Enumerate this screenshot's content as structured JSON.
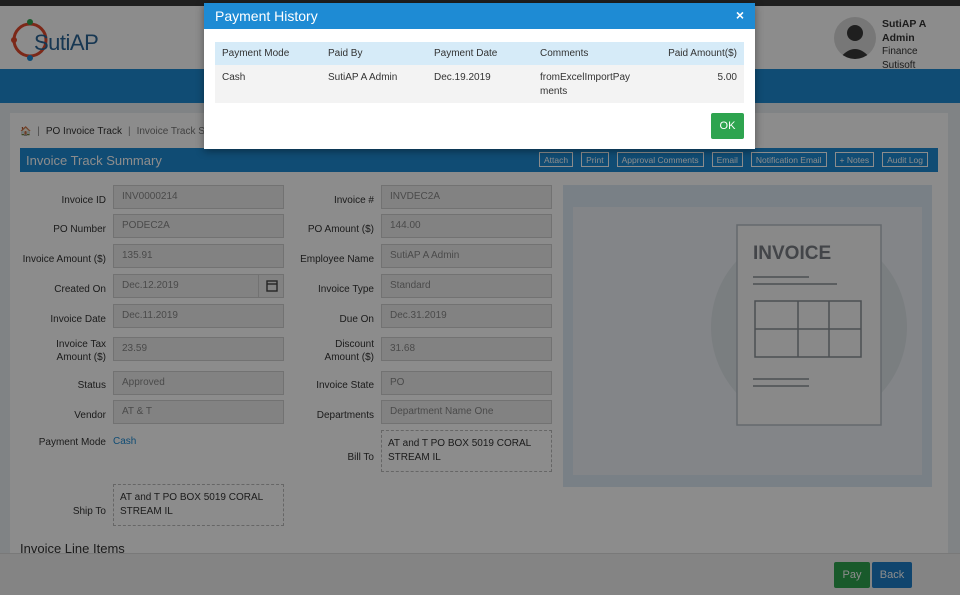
{
  "header": {
    "logo_text": "SutiAP",
    "user": {
      "name": "SutiAP A Admin",
      "role": "Finance",
      "company": "Sutisoft"
    }
  },
  "breadcrumb": {
    "home": "🏠",
    "item1": "PO Invoice Track",
    "item2": "Invoice Track Sur"
  },
  "section": {
    "title": "Invoice Track Summary",
    "toolbar": [
      "Attach",
      "Print",
      "Approval Comments",
      "Email",
      "Notification Email",
      "+ Notes",
      "Audit Log"
    ]
  },
  "form": {
    "invoice_id": {
      "label": "Invoice ID",
      "value": "INV0000214"
    },
    "po_number": {
      "label": "PO Number",
      "value": "PODEC2A"
    },
    "invoice_amount": {
      "label": "Invoice Amount ($)",
      "value": "135.91"
    },
    "created_on": {
      "label": "Created On",
      "value": "Dec.12.2019"
    },
    "invoice_date": {
      "label": "Invoice Date",
      "value": "Dec.11.2019"
    },
    "invoice_tax_label1": "Invoice Tax",
    "invoice_tax_label2": "Amount ($)",
    "invoice_tax": "23.59",
    "status": {
      "label": "Status",
      "value": "Approved"
    },
    "vendor": {
      "label": "Vendor",
      "value": "AT & T"
    },
    "payment_mode": {
      "label": "Payment Mode",
      "value": "Cash"
    },
    "ship_to": {
      "label": "Ship To",
      "line1": "AT and T PO BOX 5019 CORAL",
      "line2": "STREAM IL"
    },
    "invoice_no": {
      "label": "Invoice #",
      "value": "INVDEC2A"
    },
    "po_amount": {
      "label": "PO Amount ($)",
      "value": "144.00"
    },
    "employee_name": {
      "label": "Employee Name",
      "value": "SutiAP A Admin"
    },
    "invoice_type": {
      "label": "Invoice Type",
      "value": "Standard"
    },
    "due_on": {
      "label": "Due On",
      "value": "Dec.31.2019"
    },
    "discount_label1": "Discount",
    "discount_label2": "Amount ($)",
    "discount": "31.68",
    "invoice_state": {
      "label": "Invoice State",
      "value": "PO"
    },
    "departments": {
      "label": "Departments",
      "value": "Department Name One"
    },
    "bill_to": {
      "label": "Bill To",
      "line1": "AT and T PO BOX 5019 CORAL",
      "line2": "STREAM IL"
    }
  },
  "invoice_graphic": {
    "title": "INVOICE"
  },
  "line_items": {
    "title": "Invoice Line Items"
  },
  "footer": {
    "pay": "Pay",
    "back": "Back"
  },
  "modal": {
    "title": "Payment History",
    "close": "×",
    "columns": [
      "Payment Mode",
      "Paid By",
      "Payment Date",
      "Comments",
      "Paid Amount($)"
    ],
    "rows": [
      {
        "mode": "Cash",
        "paid_by": "SutiAP A Admin",
        "date": "Dec.19.2019",
        "comments": "fromExcelImportPayments",
        "amount": "5.00"
      }
    ],
    "ok": "OK"
  },
  "colors": {
    "primary": "#1e8bd4",
    "success": "#2ea44f",
    "header_bg": "#d6ebf8"
  }
}
